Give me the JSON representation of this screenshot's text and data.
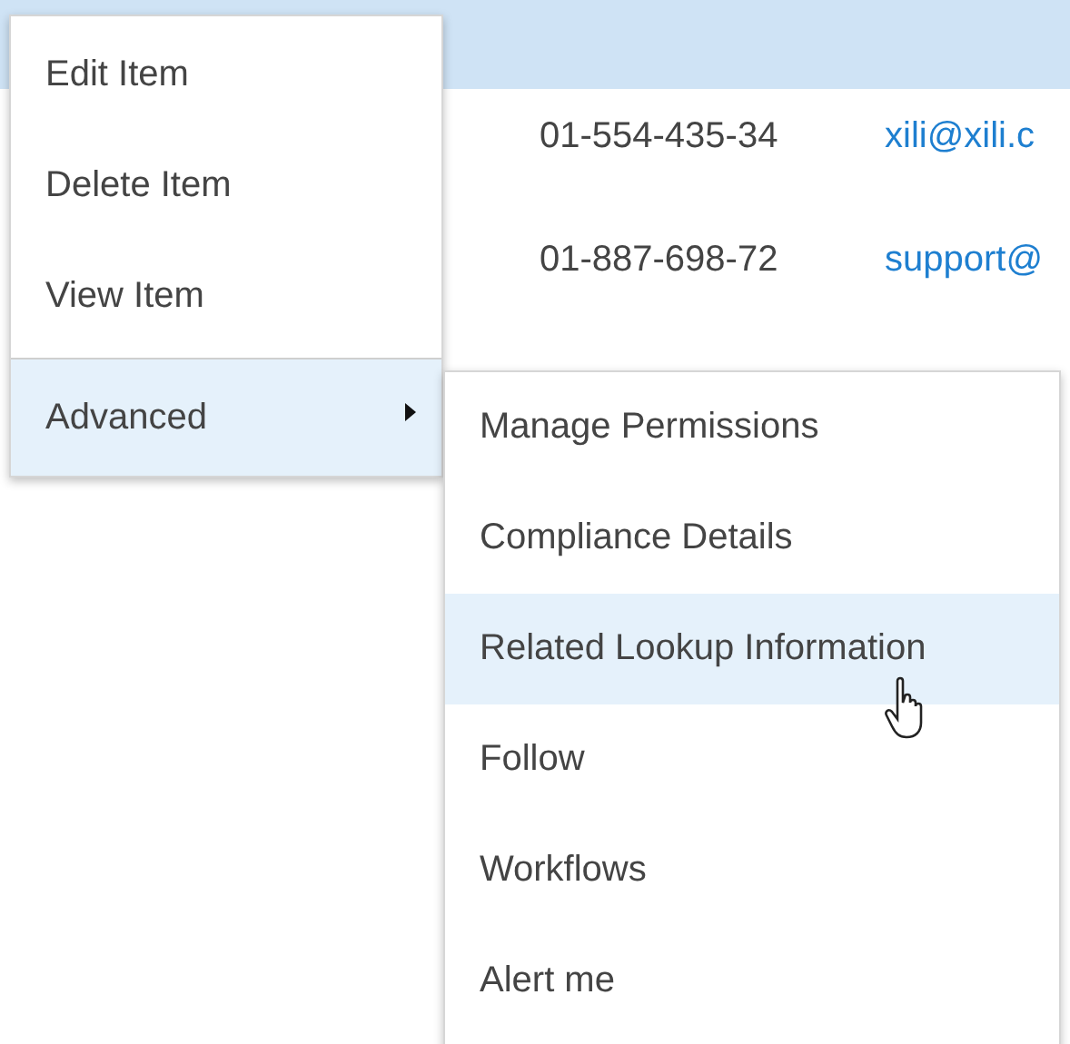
{
  "table": {
    "rows": [
      {
        "phone": "01-554-435-34",
        "email": "xili@xili.c"
      },
      {
        "phone": "01-887-698-72",
        "email": "support@"
      }
    ]
  },
  "context_menu": {
    "items": [
      {
        "label": "Edit Item",
        "selected": false,
        "has_submenu": false
      },
      {
        "label": "Delete Item",
        "selected": false,
        "has_submenu": false
      },
      {
        "label": "View Item",
        "selected": false,
        "has_submenu": false
      },
      {
        "label": "Advanced",
        "selected": true,
        "has_submenu": true
      }
    ]
  },
  "submenu": {
    "items": [
      {
        "label": "Manage Permissions",
        "selected": false
      },
      {
        "label": "Compliance Details",
        "selected": false
      },
      {
        "label": "Related Lookup Information",
        "selected": true
      },
      {
        "label": "Follow",
        "selected": false
      },
      {
        "label": "Workflows",
        "selected": false
      },
      {
        "label": "Alert me",
        "selected": false
      }
    ]
  }
}
